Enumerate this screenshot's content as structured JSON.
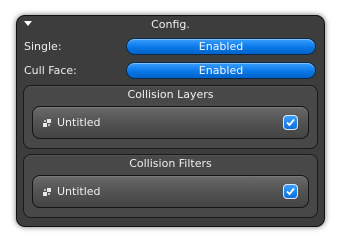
{
  "panel": {
    "title": "Config.",
    "rows": [
      {
        "label": "Single:",
        "value": "Enabled"
      },
      {
        "label": "Cull Face:",
        "value": "Enabled"
      }
    ],
    "groups": [
      {
        "title": "Collision Layers",
        "item": {
          "label": "Untitled",
          "icon": "layer-icon",
          "checked": true
        }
      },
      {
        "title": "Collision Filters",
        "item": {
          "label": "Untitled",
          "icon": "layer-icon",
          "checked": true
        }
      }
    ]
  },
  "colors": {
    "panel_bg": "#3d3d3d",
    "accent": "#0a78e8",
    "text": "#eeeeee"
  }
}
